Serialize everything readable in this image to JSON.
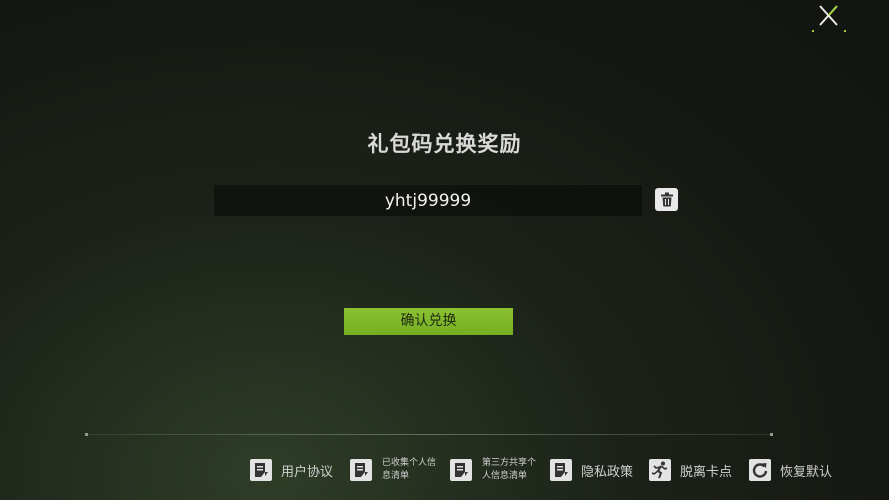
{
  "dialog": {
    "title": "礼包码兑换奖励",
    "code_value": "yhtj99999",
    "confirm_label": "确认兑换"
  },
  "icons": {
    "close": "close-icon",
    "delete": "trash-icon"
  },
  "colors": {
    "accent": "#7fb52a",
    "background": "#161a14",
    "text": "#d9d9d9"
  },
  "footer": {
    "items": [
      {
        "label": "用户协议",
        "icon": "document-icon"
      },
      {
        "label": "已收集个人信息清单",
        "icon": "document-icon"
      },
      {
        "label": "第三方共享个人信息清单",
        "icon": "document-icon"
      },
      {
        "label": "隐私政策",
        "icon": "document-icon"
      },
      {
        "label": "脱离卡点",
        "icon": "running-person-icon"
      },
      {
        "label": "恢复默认",
        "icon": "refresh-icon"
      }
    ]
  }
}
